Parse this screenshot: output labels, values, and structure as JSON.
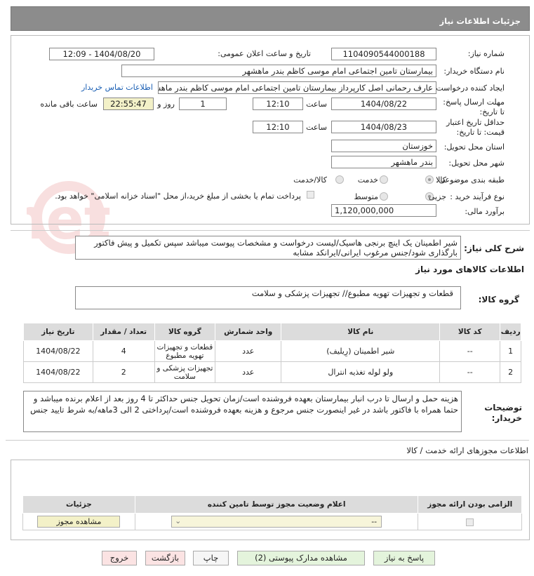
{
  "header": {
    "title": "جزئیات اطلاعات نیاز"
  },
  "form": {
    "need_number_label": "شماره نیاز:",
    "need_number": "1104090544000188",
    "announce_label": "تاریخ و ساعت اعلان عمومی:",
    "announce_value": "1404/08/20 - 12:09",
    "buyer_label": "نام دستگاه خریدار:",
    "buyer": "بیمارستان تامین اجتماعی امام موسی کاظم بندر ماهشهر",
    "creator_label": "ایجاد کننده درخواست:",
    "creator": "عارف رحمانی اصل کارپرداز بیمارستان تامین اجتماعی امام موسی کاظم بندر ماهشهر",
    "contact_link": "اطلاعات تماس خریدار",
    "deadline_label": "مهلت ارسال پاسخ: تا تاریخ:",
    "deadline_date": "1404/08/22",
    "time_label": "ساعت",
    "deadline_time": "12:10",
    "days": "1",
    "days_label": "روز و",
    "remaining": "22:55:47",
    "remaining_label": "ساعت باقی مانده",
    "validity_label": "حداقل تاریخ اعتبار قیمت: تا تاریخ:",
    "validity_date": "1404/08/23",
    "validity_time_label": "ساعت",
    "validity_time": "12:10",
    "province_label": "استان محل تحویل:",
    "province": "خوزستان",
    "city_label": "شهر محل تحویل:",
    "city": "بندر ماهشهر",
    "category_label": "طبقه بندی موضوعی:",
    "category_options": [
      "کالا",
      "خدمت",
      "کالا/خدمت"
    ],
    "process_label": "نوع فرآیند خرید :",
    "process_options": [
      "جزیی",
      "متوسط"
    ],
    "payment_note": "پرداخت تمام یا بخشی از مبلغ خرید،از محل \"اسناد خزانه اسلامی\" خواهد بود.",
    "budget_label": "برآورد مالی:",
    "budget": "1,120,000,000"
  },
  "description": {
    "label": "شرح کلی نیاز:",
    "text": "شیر اطمینان یک اینچ برنجی هاسیک/لیست درخواست و مشخصات پیوست میباشد سپس تکمیل و پیش فاکتور بارگذاری شود/جنس مرغوب ایرانی/ایرانکد مشابه"
  },
  "goods": {
    "title": "اطلاعات کالاهای مورد نیاز",
    "group_label": "گروه کالا:",
    "group_value": "قطعات و تجهیزات تهویه مطبوع// تجهیزات پزشکی و سلامت",
    "headers": [
      "ردیف",
      "کد کالا",
      "نام کالا",
      "واحد شمارش",
      "گروه کالا",
      "تعداد / مقدار",
      "تاریخ نیاز"
    ],
    "rows": [
      [
        "1",
        "--",
        "شیر اطمینان (رِیلیف)",
        "عدد",
        "قطعات و تجهیزات تهویه مطبوع",
        "4",
        "1404/08/22"
      ],
      [
        "2",
        "--",
        "ولو لوله تغذیه انترال",
        "عدد",
        "تجهیزات پزشکی و سلامت",
        "2",
        "1404/08/22"
      ]
    ]
  },
  "buyer_notes": {
    "label": "توضیحات خریدار:",
    "text": "هزینه حمل و ارسال تا درب انبار بیمارستان بعهده فروشنده است/زمان تحویل جنس حداکثر تا 4 روز بعد از اعلام برنده میباشد و حتما همراه با فاکتور باشد در غیر اینصورت جنس مرجوع و هزینه بعهده فروشنده است/پرداختی 2 الی 3ماهه/به شرط تایید جنس"
  },
  "permits": {
    "title": "اطلاعات مجوزهای ارائه خدمت / کالا",
    "headers": [
      "الزامی بودن ارائه مجوز",
      "اعلام وضعیت مجوز توسط تامین کننده",
      "جزئیات"
    ],
    "select_value": "--",
    "view_button": "مشاهده مجوز"
  },
  "buttons": {
    "reply": "پاسخ به نیاز",
    "docs": "مشاهده مدارک پیوستی (2)",
    "print": "چاپ",
    "back": "بازگشت",
    "exit": "خروج"
  },
  "watermark": "AriaTender.net"
}
